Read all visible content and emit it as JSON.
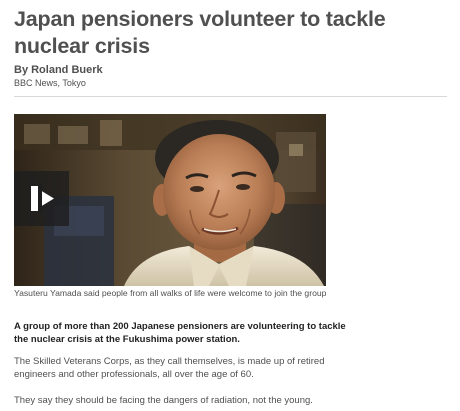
{
  "article": {
    "headline": "Japan pensioners volunteer to tackle nuclear crisis",
    "author": "By Roland Buerk",
    "location": "BBC News, Tokyo",
    "media": {
      "play_icon": "play-icon",
      "caption": "Yasuteru Yamada said people from all walks of life were welcome to join the group"
    },
    "intro": "A group of more than 200 Japanese pensioners are volunteering to tackle the nuclear crisis at the Fukushima power station.",
    "paragraphs": [
      "The Skilled Veterans Corps, as they call themselves, is made up of retired engineers and other professionals, all over the age of 60.",
      "They say they should be facing the dangers of radiation, not the young."
    ]
  },
  "colors": {
    "headline": "#505050",
    "body_text": "#505050",
    "intro_text": "#222222",
    "divider": "#d8d8d8",
    "play_box": "#1e1e1e"
  }
}
